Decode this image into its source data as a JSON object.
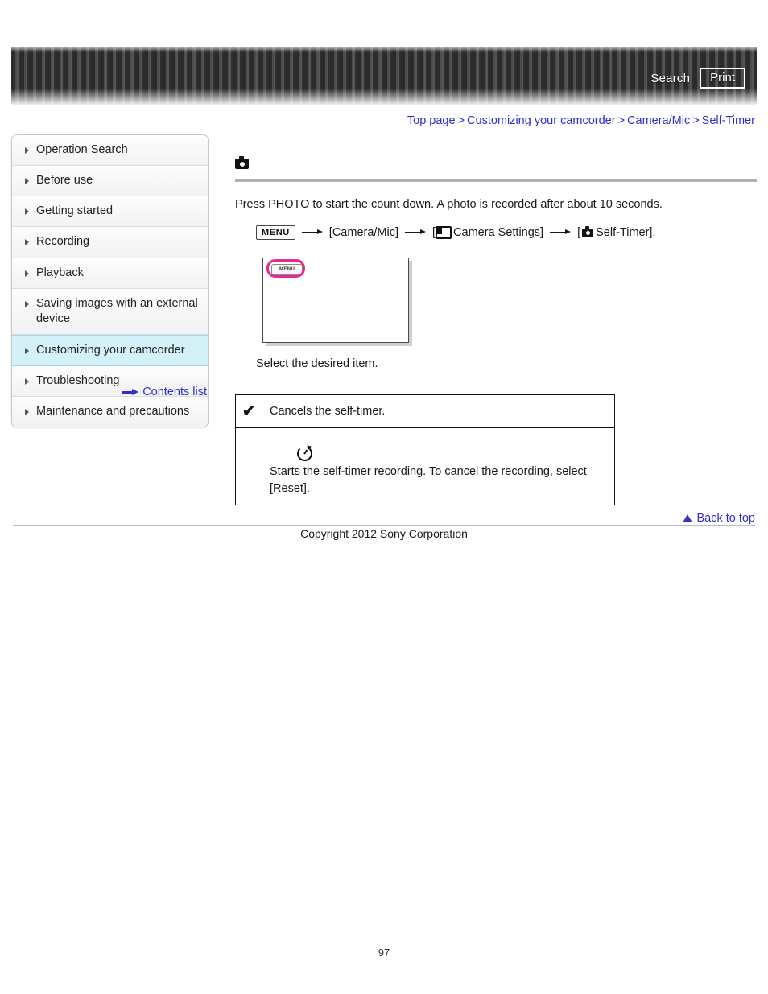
{
  "header": {
    "search_label": "Search",
    "print_label": "Print"
  },
  "breadcrumb": {
    "items": [
      {
        "label": "Top page"
      },
      {
        "label": "Customizing your camcorder"
      },
      {
        "label": "Camera/Mic"
      },
      {
        "label": "Self-Timer"
      }
    ],
    "separator": ">"
  },
  "sidebar": {
    "items": [
      {
        "label": "Operation Search",
        "active": false
      },
      {
        "label": "Before use",
        "active": false
      },
      {
        "label": "Getting started",
        "active": false
      },
      {
        "label": "Recording",
        "active": false
      },
      {
        "label": "Playback",
        "active": false
      },
      {
        "label": "Saving images with an external device",
        "active": false
      },
      {
        "label": "Customizing your camcorder",
        "active": true
      },
      {
        "label": "Troubleshooting",
        "active": false
      },
      {
        "label": "Maintenance and precautions",
        "active": false
      }
    ],
    "contents_list_label": "Contents list"
  },
  "main": {
    "mode_icon": "photo-camera-icon",
    "lead_text": "Press PHOTO to start the count down. A photo is recorded after about 10 seconds.",
    "menu_path": {
      "menu_chip_label": "MENU",
      "step_camera_mic": "[Camera/Mic]",
      "step_camera_settings_open": "[",
      "step_camera_settings_label": "Camera Settings]",
      "step_self_timer_open": "[",
      "step_self_timer_label": "Self-Timer].",
      "camera_settings_icon": "monitor-icon",
      "self_timer_icon": "photo-camera-icon"
    },
    "screen_illustration": {
      "menu_button_label": "MENU",
      "highlight_color": "#ec268f"
    },
    "select_text": "Select the desired item.",
    "options_table": {
      "rows": [
        {
          "checked": true,
          "check_glyph": "✔",
          "icon": null,
          "description": "Cancels the self-timer."
        },
        {
          "checked": false,
          "check_glyph": "",
          "icon": "self-timer-icon",
          "description": "Starts the self-timer recording. To cancel the recording, select [Reset]."
        }
      ]
    }
  },
  "footer": {
    "back_to_top_label": "Back to top",
    "copyright": "Copyright 2012 Sony Corporation",
    "page_number": "97"
  }
}
